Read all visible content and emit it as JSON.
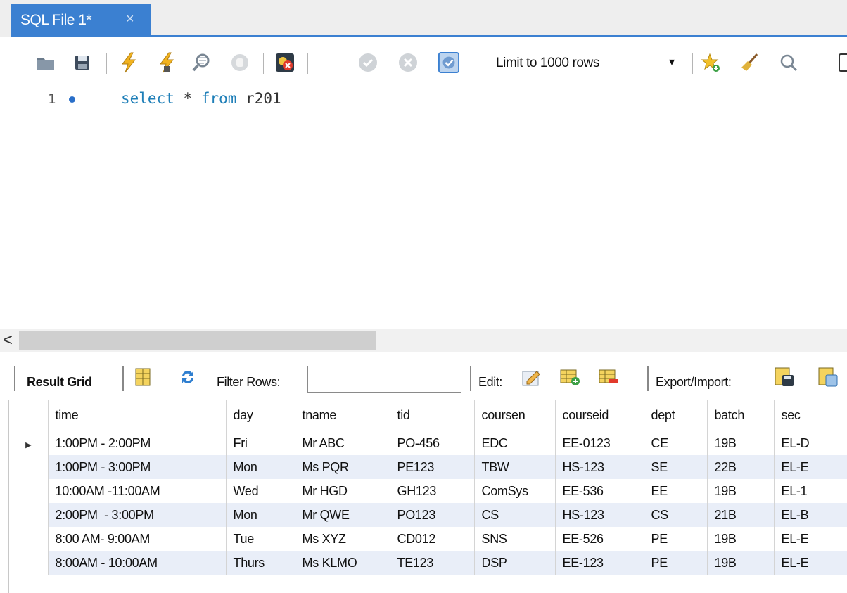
{
  "tab": {
    "title": "SQL File 1*",
    "close": "×"
  },
  "toolbar": {
    "limit_label": "Limit to 1000 rows",
    "limit_arrow": "▾"
  },
  "editor": {
    "line_number": "1",
    "keyword_select": "select",
    "star": "*",
    "keyword_from": "from",
    "table": "r201"
  },
  "scroll": {
    "left_arrow": "<"
  },
  "result_toolbar": {
    "result_grid": "Result Grid",
    "filter_rows": "Filter Rows:",
    "filter_value": "",
    "edit": "Edit:",
    "export_import": "Export/Import:"
  },
  "grid": {
    "columns": [
      "time",
      "day",
      "tname",
      "tid",
      "coursen",
      "courseid",
      "dept",
      "batch",
      "sec"
    ],
    "rows": [
      [
        "1:00PM - 2:00PM",
        "Fri",
        "Mr ABC",
        "PO-456",
        "EDC",
        "EE-0123",
        "CE",
        "19B",
        "EL-D"
      ],
      [
        "1:00PM - 3:00PM",
        "Mon",
        "Ms PQR",
        "PE123",
        "TBW",
        "HS-123",
        "SE",
        "22B",
        "EL-E"
      ],
      [
        "10:00AM -11:00AM",
        "Wed",
        "Mr HGD",
        "GH123",
        "ComSys",
        "EE-536",
        "EE",
        "19B",
        "EL-1"
      ],
      [
        "2:00PM  - 3:00PM",
        "Mon",
        "Mr QWE",
        "PO123",
        "CS",
        "HS-123",
        "CS",
        "21B",
        "EL-B"
      ],
      [
        "8:00 AM- 9:00AM",
        "Tue",
        "Ms XYZ",
        "CD012",
        "SNS",
        "EE-526",
        "PE",
        "19B",
        "EL-E"
      ],
      [
        "8:00AM - 10:00AM",
        "Thurs",
        "Ms KLMO",
        "TE123",
        "DSP",
        "EE-123",
        "PE",
        "19B",
        "EL-E"
      ]
    ],
    "current_row_marker": "▶"
  }
}
